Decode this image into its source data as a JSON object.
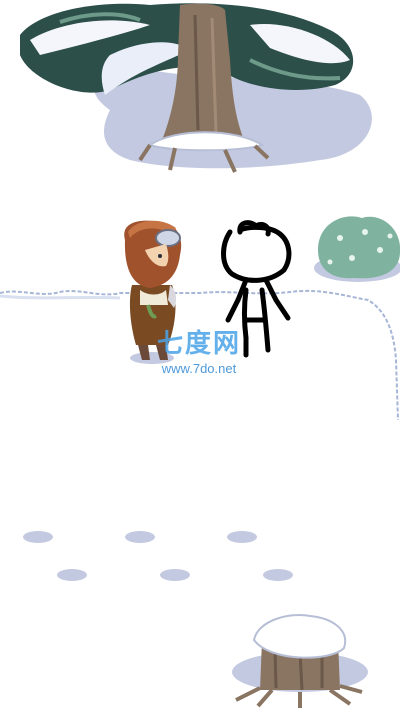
{
  "watermark": {
    "site_name": "七度网",
    "url": "www.7do.net"
  },
  "colors": {
    "snow": "#ffffff",
    "snow_shadow": "#c3c9e0",
    "pine_dark": "#2c4f4a",
    "pine_light": "#6e9a8a",
    "trunk": "#8a7562",
    "bush": "#7fb3a0",
    "hair": "#a0522d",
    "coat": "#7a4a22",
    "brand_blue": "#4aa3e8"
  },
  "sprites": {
    "tree": "snowy-pine-tree",
    "stump": "snowy-tree-stump",
    "bush": "snow-bush",
    "player": "brown-haired-hero-sprite",
    "npc": "stick-figure-npc"
  }
}
